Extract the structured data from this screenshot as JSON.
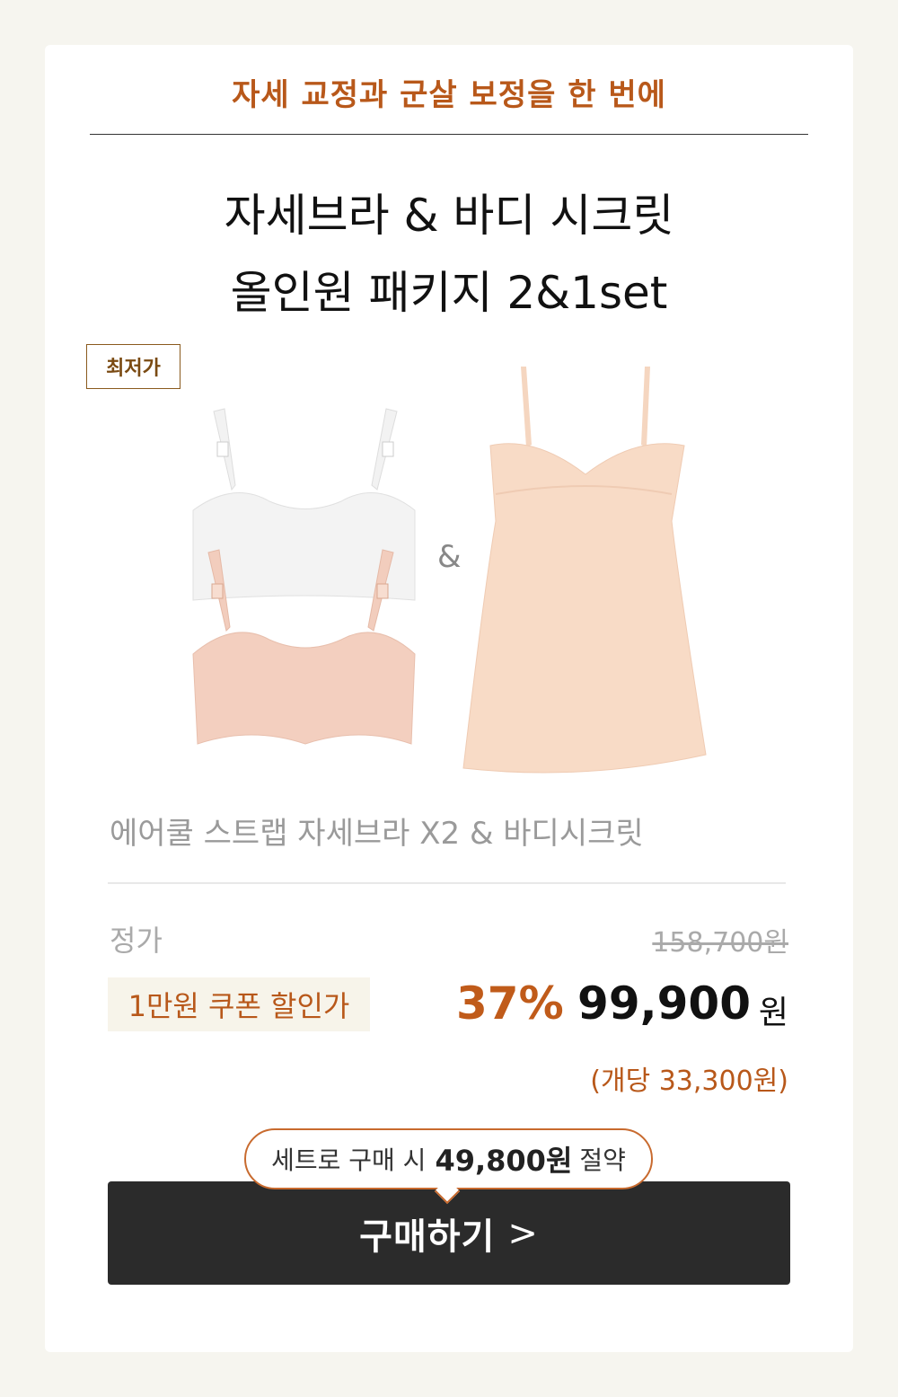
{
  "tagline": "자세 교정과 군살 보정을 한 번에",
  "title": {
    "line1": "자세브라 & 바디 시크릿",
    "line2": "올인원 패키지 2&1set"
  },
  "badge": "최저가",
  "products_separator": "&",
  "product_name": "에어쿨 스트랩 자세브라 X2 & 바디시크릿",
  "price": {
    "regular_label": "정가",
    "regular_price": "158,700원",
    "coupon_label": "1만원 쿠폰 할인가",
    "discount_rate": "37%",
    "sale_price": "99,900",
    "currency": "원",
    "per_unit": "(개당 33,300원)"
  },
  "savings": {
    "prefix": "세트로 구매 시",
    "amount": "49,800원",
    "suffix": "절약"
  },
  "buy_button": {
    "label": "구매하기",
    "chevron": ">"
  },
  "colors": {
    "accent": "#b8581a",
    "button": "#2b2b2b",
    "background": "#f6f5ef"
  }
}
